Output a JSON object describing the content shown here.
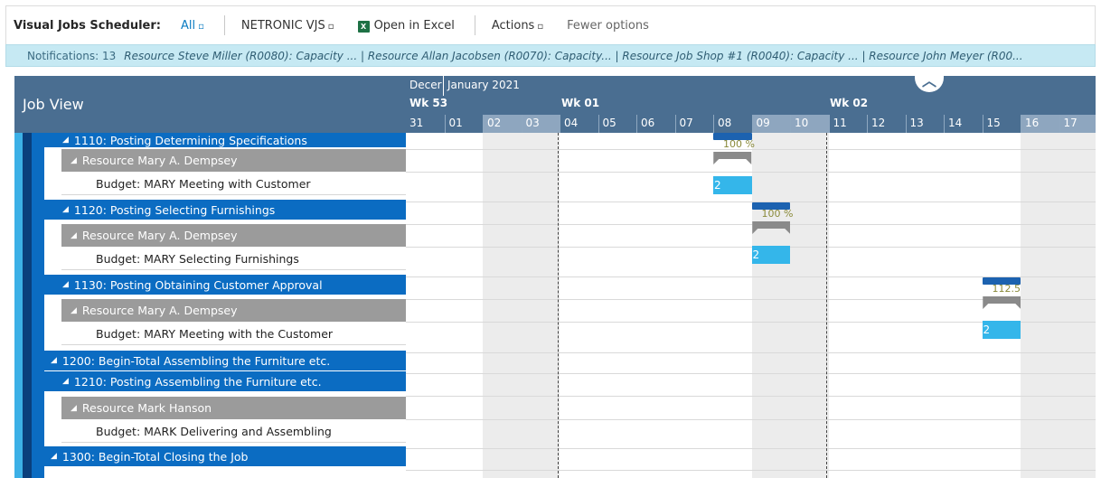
{
  "toolbar": {
    "title": "Visual Jobs Scheduler:",
    "all_label": "All",
    "netronic_label": "NETRONIC VJS",
    "excel_label": "Open in Excel",
    "actions_label": "Actions",
    "fewer_label": "Fewer options",
    "chevron": "▫"
  },
  "notifications": {
    "count_label": "Notifications: 13",
    "messages": "Resource Steve Miller (R0080): Capacity ...  |  Resource Allan Jacobsen (R0070): Capacity...  |  Resource Job Shop #1 (R0040): Capacity ...  |  Resource John Meyer (R00..."
  },
  "header": {
    "job_view_label": "Job View",
    "month_dec": "Decer",
    "month_jan": "January 2021",
    "weeks": [
      "Wk 53",
      "Wk 01",
      "Wk 02"
    ],
    "days": [
      "31",
      "01",
      "02",
      "03",
      "04",
      "05",
      "06",
      "07",
      "08",
      "09",
      "10",
      "11",
      "12",
      "13",
      "14",
      "15",
      "16",
      "17"
    ]
  },
  "tree": {
    "rows": [
      {
        "type": "task",
        "label": "1110: Posting Determining Specifications"
      },
      {
        "type": "res",
        "label": "Resource Mary A. Dempsey"
      },
      {
        "type": "bud",
        "label": "Budget: MARY Meeting with Customer"
      },
      {
        "type": "task",
        "label": "1120: Posting Selecting Furnishings"
      },
      {
        "type": "res",
        "label": "Resource Mary A. Dempsey"
      },
      {
        "type": "bud",
        "label": "Budget: MARY Selecting Furnishings"
      },
      {
        "type": "task",
        "label": "1130: Posting Obtaining Customer Approval"
      },
      {
        "type": "res",
        "label": "Resource Mary A. Dempsey"
      },
      {
        "type": "bud",
        "label": "Budget: MARY Meeting with the Customer"
      },
      {
        "type": "task",
        "label": "1200: Begin-Total Assembling the Furniture etc."
      },
      {
        "type": "task",
        "label": "1210: Posting Assembling the Furniture etc."
      },
      {
        "type": "res",
        "label": "Resource Mark Hanson"
      },
      {
        "type": "bud",
        "label": "Budget: MARK Delivering and Assembling"
      },
      {
        "type": "task",
        "label": "1300: Begin-Total Closing the Job"
      }
    ]
  },
  "gantt": {
    "summary_bars": [
      {
        "label": "100 %",
        "day_index": 8
      },
      {
        "label": "100 %",
        "day_index": 9
      },
      {
        "label": "112.5",
        "day_index": 15
      }
    ],
    "budget_bars": [
      {
        "label": "2",
        "day_index": 8
      },
      {
        "label": "2",
        "day_index": 9
      },
      {
        "label": "2",
        "day_index": 15
      }
    ]
  },
  "colors": {
    "header_bg": "#4a6e91",
    "task_row": "#0b6cc2",
    "resource_row": "#9b9b9b",
    "budget_bar": "#34b6ea",
    "summary_bar": "#1c62b0",
    "notification_bg": "#c6e9f3",
    "link": "#0a7bc2"
  }
}
